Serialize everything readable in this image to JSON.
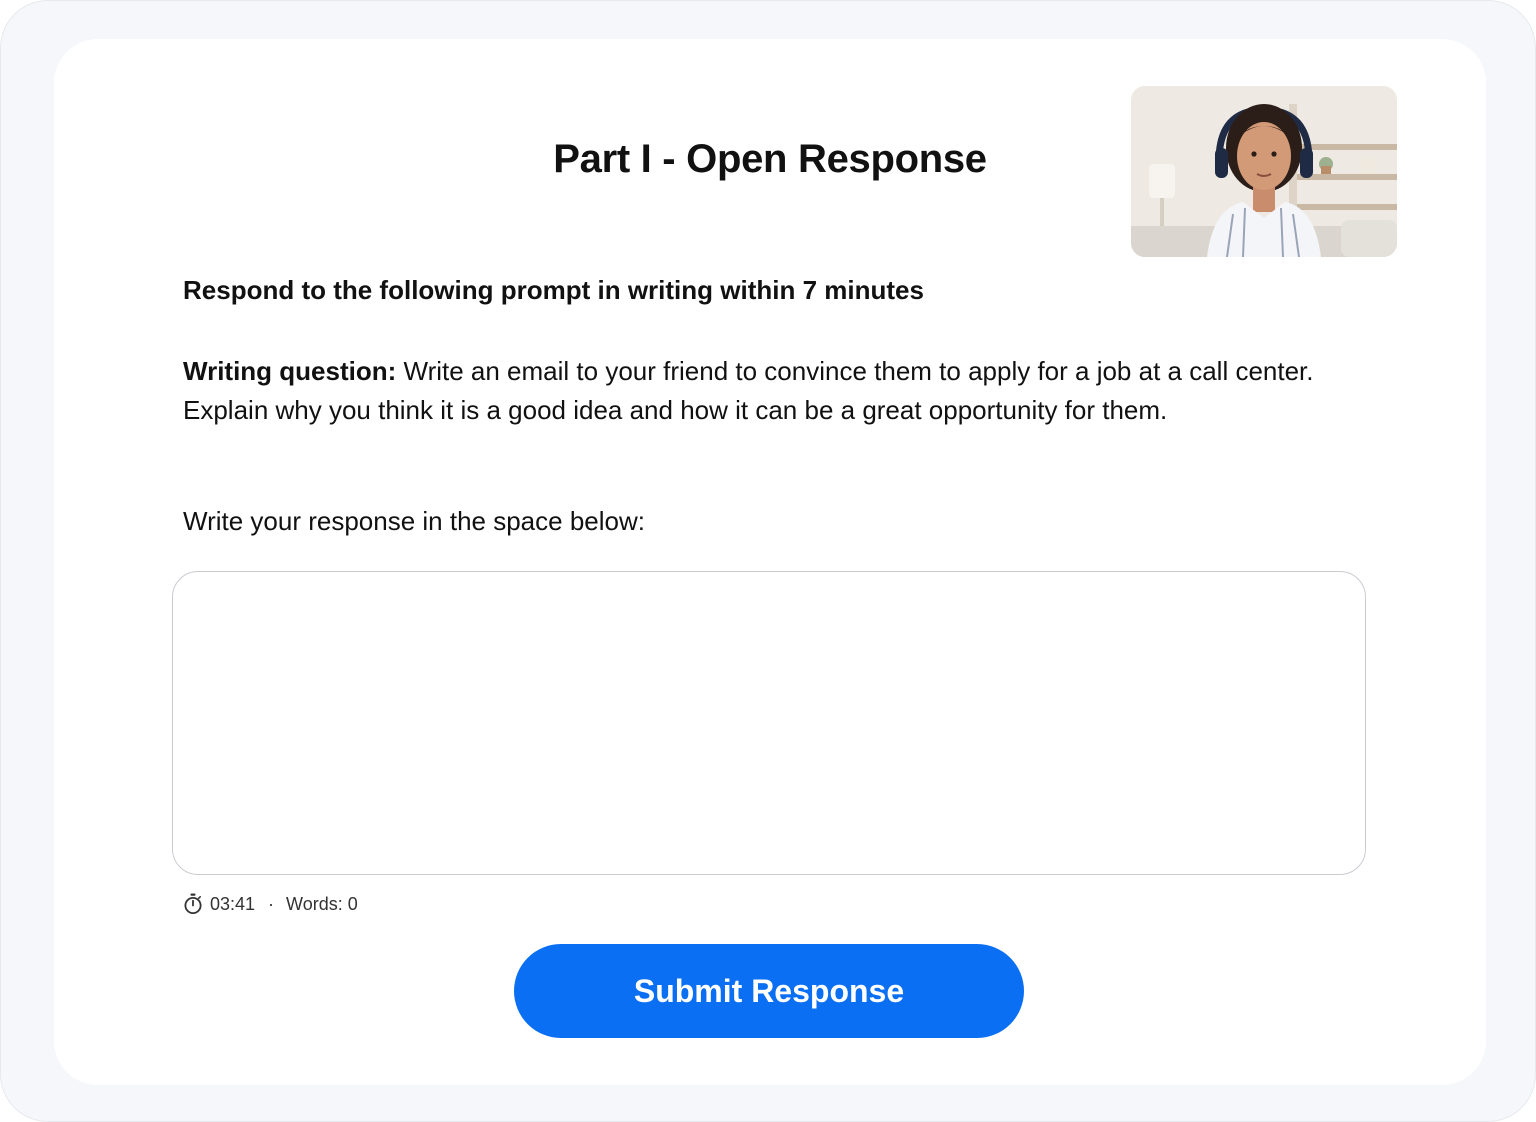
{
  "header": {
    "title": "Part I - Open Response"
  },
  "webcam": {
    "icon": "webcam-feed-image"
  },
  "prompt": {
    "instruction": "Respond to the following prompt in writing within 7 minutes",
    "question_label": "Writing question:",
    "question_text": " Write an email to your friend to convince them to apply for a job at a call center. Explain why you think it is a good idea and how it can be a great opportunity for them."
  },
  "response": {
    "label": "Write your response in the space below:",
    "value": "",
    "placeholder": ""
  },
  "status": {
    "timer_icon": "stopwatch-icon",
    "timer": "03:41",
    "separator": "·",
    "words_label": "Words: 0"
  },
  "actions": {
    "submit_label": "Submit Response"
  },
  "colors": {
    "accent": "#0a6ff2",
    "frame": "#f5f7fa",
    "text": "#111111"
  }
}
